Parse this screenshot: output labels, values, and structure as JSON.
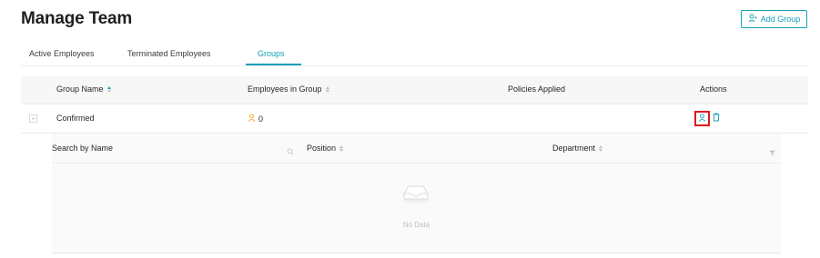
{
  "page": {
    "title": "Manage Team"
  },
  "header": {
    "add_group_label": "Add Group"
  },
  "tabs": [
    {
      "label": "Active Employees",
      "active": false
    },
    {
      "label": "Terminated Employees",
      "active": false
    },
    {
      "label": "Groups",
      "active": true
    }
  ],
  "table": {
    "columns": [
      "Group Name",
      "Employees in Group",
      "Policies Applied",
      "Actions"
    ],
    "rows": [
      {
        "expand": "-",
        "group_name": "Confirmed",
        "employees": "0",
        "policies": ""
      }
    ]
  },
  "nested": {
    "columns": [
      "Search by Name",
      "Position",
      "Department"
    ],
    "empty_text": "No Data"
  },
  "colors": {
    "accent": "#14a0b8",
    "highlight": "#e01a1a",
    "user_icon": "#f5a623"
  }
}
